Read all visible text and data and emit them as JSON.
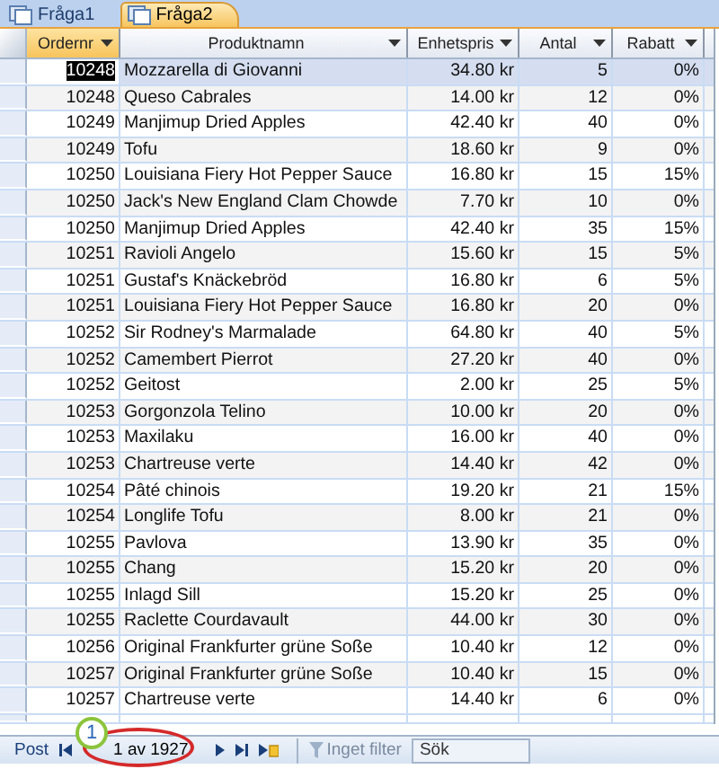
{
  "tabs": [
    {
      "label": "Fråga1",
      "selected": false
    },
    {
      "label": "Fråga2",
      "selected": true
    }
  ],
  "columns": [
    {
      "label": "Ordernr",
      "selected": true
    },
    {
      "label": "Produktnamn",
      "selected": false
    },
    {
      "label": "Enhetspris",
      "selected": false
    },
    {
      "label": "Antal",
      "selected": false
    },
    {
      "label": "Rabatt",
      "selected": false
    }
  ],
  "rows": [
    {
      "cells": [
        "10248",
        "Mozzarella di Giovanni",
        "34.80 kr",
        "5",
        "0%"
      ],
      "selected": true
    },
    {
      "cells": [
        "10248",
        "Queso Cabrales",
        "14.00 kr",
        "12",
        "0%"
      ],
      "selected": false
    },
    {
      "cells": [
        "10249",
        "Manjimup Dried Apples",
        "42.40 kr",
        "40",
        "0%"
      ],
      "selected": false
    },
    {
      "cells": [
        "10249",
        "Tofu",
        "18.60 kr",
        "9",
        "0%"
      ],
      "selected": false
    },
    {
      "cells": [
        "10250",
        "Louisiana Fiery Hot Pepper Sauce",
        "16.80 kr",
        "15",
        "15%"
      ],
      "selected": false
    },
    {
      "cells": [
        "10250",
        "Jack's New England Clam Chowde",
        "7.70 kr",
        "10",
        "0%"
      ],
      "selected": false
    },
    {
      "cells": [
        "10250",
        "Manjimup Dried Apples",
        "42.40 kr",
        "35",
        "15%"
      ],
      "selected": false
    },
    {
      "cells": [
        "10251",
        "Ravioli Angelo",
        "15.60 kr",
        "15",
        "5%"
      ],
      "selected": false
    },
    {
      "cells": [
        "10251",
        "Gustaf's Knäckebröd",
        "16.80 kr",
        "6",
        "5%"
      ],
      "selected": false
    },
    {
      "cells": [
        "10251",
        "Louisiana Fiery Hot Pepper Sauce",
        "16.80 kr",
        "20",
        "0%"
      ],
      "selected": false
    },
    {
      "cells": [
        "10252",
        "Sir Rodney's Marmalade",
        "64.80 kr",
        "40",
        "5%"
      ],
      "selected": false
    },
    {
      "cells": [
        "10252",
        "Camembert Pierrot",
        "27.20 kr",
        "40",
        "0%"
      ],
      "selected": false
    },
    {
      "cells": [
        "10252",
        "Geitost",
        "2.00 kr",
        "25",
        "5%"
      ],
      "selected": false
    },
    {
      "cells": [
        "10253",
        "Gorgonzola Telino",
        "10.00 kr",
        "20",
        "0%"
      ],
      "selected": false
    },
    {
      "cells": [
        "10253",
        "Maxilaku",
        "16.00 kr",
        "40",
        "0%"
      ],
      "selected": false
    },
    {
      "cells": [
        "10253",
        "Chartreuse verte",
        "14.40 kr",
        "42",
        "0%"
      ],
      "selected": false
    },
    {
      "cells": [
        "10254",
        "Pâté chinois",
        "19.20 kr",
        "21",
        "15%"
      ],
      "selected": false
    },
    {
      "cells": [
        "10254",
        "Longlife Tofu",
        "8.00 kr",
        "21",
        "0%"
      ],
      "selected": false
    },
    {
      "cells": [
        "10255",
        "Pavlova",
        "13.90 kr",
        "35",
        "0%"
      ],
      "selected": false
    },
    {
      "cells": [
        "10255",
        "Chang",
        "15.20 kr",
        "20",
        "0%"
      ],
      "selected": false
    },
    {
      "cells": [
        "10255",
        "Inlagd Sill",
        "15.20 kr",
        "25",
        "0%"
      ],
      "selected": false
    },
    {
      "cells": [
        "10255",
        "Raclette Courdavault",
        "44.00 kr",
        "30",
        "0%"
      ],
      "selected": false
    },
    {
      "cells": [
        "10256",
        "Original Frankfurter grüne Soße",
        "10.40 kr",
        "12",
        "0%"
      ],
      "selected": false
    },
    {
      "cells": [
        "10257",
        "Original Frankfurter grüne Soße",
        "10.40 kr",
        "15",
        "0%"
      ],
      "selected": false
    },
    {
      "cells": [
        "10257",
        "Chartreuse verte",
        "14.40 kr",
        "6",
        "0%"
      ],
      "selected": false
    }
  ],
  "navigation": {
    "label": "Post",
    "record": "1 av 1927",
    "filter": "Inget filter",
    "search": {
      "placeholder": "Sök"
    }
  },
  "callout": {
    "number": "1"
  }
}
